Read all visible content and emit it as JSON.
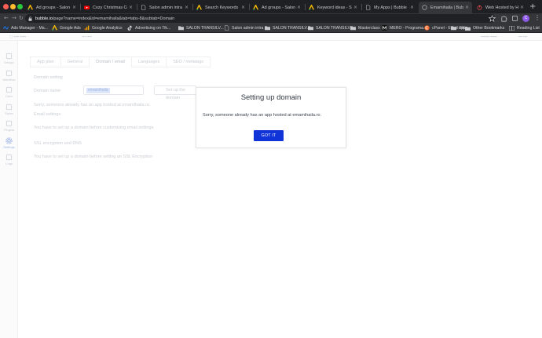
{
  "browser": {
    "tabs": [
      {
        "label": "Ad groups - Salon Tra",
        "favicon": "google-ads-icon",
        "color": "#fbbc04"
      },
      {
        "label": "Cozy Christmas Coffe",
        "favicon": "youtube-icon",
        "color": "#ff0000"
      },
      {
        "label": "Salon admin intra",
        "favicon": "blank-page-icon",
        "color": "#9aa0a6"
      },
      {
        "label": "Search Keywords - S",
        "favicon": "google-ads-icon",
        "color": "#fbbc04"
      },
      {
        "label": "Ad groups - Salon Tra",
        "favicon": "google-ads-icon",
        "color": "#fbbc04"
      },
      {
        "label": "Keyword ideas - Salo",
        "favicon": "google-ads-icon",
        "color": "#fbbc04"
      },
      {
        "label": "My Apps | Bubble",
        "favicon": "blank-page-icon",
        "color": "#9aa0a6"
      },
      {
        "label": "Emamihaila | Bubble",
        "favicon": "bubble-icon",
        "color": "#9aa0a6",
        "active": true
      },
      {
        "label": "Web Hosted by Hosti",
        "favicon": "power-icon",
        "color": "#e24a4a"
      }
    ],
    "url_host": "bubble.io",
    "url_path": "/page?name=index&id=emamihaila&tab=tabs-8&subtab=Domain",
    "profile_initial": "C",
    "bookmarks": [
      {
        "label": "Ads Manager - Ma...",
        "icon": "meta-icon",
        "color": "#1877f2"
      },
      {
        "label": "Google Ads",
        "icon": "google-ads-icon",
        "color": "#fbbc04"
      },
      {
        "label": "Google Analytics",
        "icon": "analytics-icon",
        "color": "#f9ab00"
      },
      {
        "label": "Advertising on Tik...",
        "icon": "tiktok-icon",
        "color": "#ffffff"
      },
      {
        "label": "SALON TRANSILV...",
        "icon": "folder-icon",
        "color": "#c8c9cc"
      },
      {
        "label": "Salon admin intra",
        "icon": "blank-page-icon",
        "color": "#9aa0a6"
      },
      {
        "label": "SALON TRANSILV...",
        "icon": "folder-icon",
        "color": "#c8c9cc"
      },
      {
        "label": "SALON TRANSILV...",
        "icon": "folder-icon",
        "color": "#c8c9cc"
      },
      {
        "label": "Masterclass",
        "icon": "folder-icon",
        "color": "#c8c9cc"
      },
      {
        "label": "MERO - Programa...",
        "icon": "mero-icon",
        "color": "#ffffff"
      },
      {
        "label": "cPanel - Email Filt...",
        "icon": "cpanel-icon",
        "color": "#ff6c2c"
      },
      {
        "label": "apps",
        "icon": "folder-icon",
        "color": "#c8c9cc"
      }
    ],
    "other_bookmarks": "Other Bookmarks",
    "reading_list": "Reading List"
  },
  "app": {
    "rail": [
      {
        "label": "Design",
        "icon": "design-icon"
      },
      {
        "label": "Workflow",
        "icon": "workflow-icon"
      },
      {
        "label": "Data",
        "icon": "data-icon"
      },
      {
        "label": "Styles",
        "icon": "styles-icon"
      },
      {
        "label": "Plugins",
        "icon": "plugins-icon"
      },
      {
        "label": "Settings",
        "icon": "settings-icon",
        "active": true
      },
      {
        "label": "Logs",
        "icon": "logs-icon"
      }
    ],
    "sub_tabs": [
      "App plan",
      "General",
      "Domain / email",
      "Languages",
      "SEO / metatags"
    ],
    "labels": {
      "domain_setting": "Domain setting",
      "domain_name": "Domain name",
      "domain_value": "emamihaila",
      "setup_button": "Set up the domain",
      "error": "Sorry, someone already has an app hosted at emamihaila.ro.",
      "email_settings": "Email settings",
      "email_note": "You have to set up a domain before customizing email settings",
      "ssl": "SSL encryption and DNS",
      "ssl_note": "You have to set up a domain before setting an SSL Encryption"
    }
  },
  "modal": {
    "title": "Setting up domain",
    "message": "Sorry, someone already has an app hosted at emamihaila.ro.",
    "button": "GOT IT",
    "button_color": "#1134d8"
  }
}
